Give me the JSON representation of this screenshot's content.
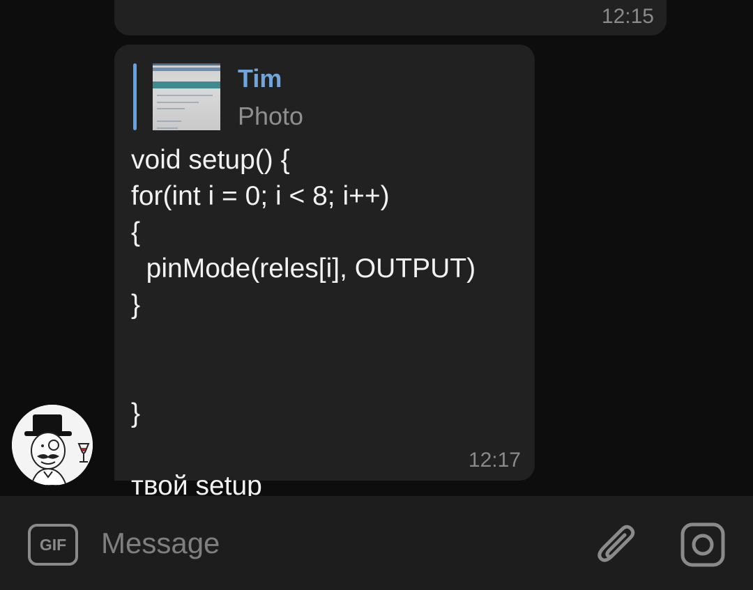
{
  "previous_message": {
    "time": "12:15"
  },
  "message": {
    "reply": {
      "name": "Tim",
      "type": "Photo"
    },
    "text": "void setup() {\nfor(int i = 0; i < 8; i++)\n{\n  pinMode(reles[i], OUTPUT)\n}\n\n\n}\n\nтвой setup",
    "time": "12:17",
    "bubble_color": "#212121",
    "name_color": "#6ea6dd"
  },
  "input_bar": {
    "gif_label": "GIF",
    "placeholder": "Message",
    "icons": {
      "attach": "paperclip-icon",
      "camera": "camera-icon"
    }
  }
}
